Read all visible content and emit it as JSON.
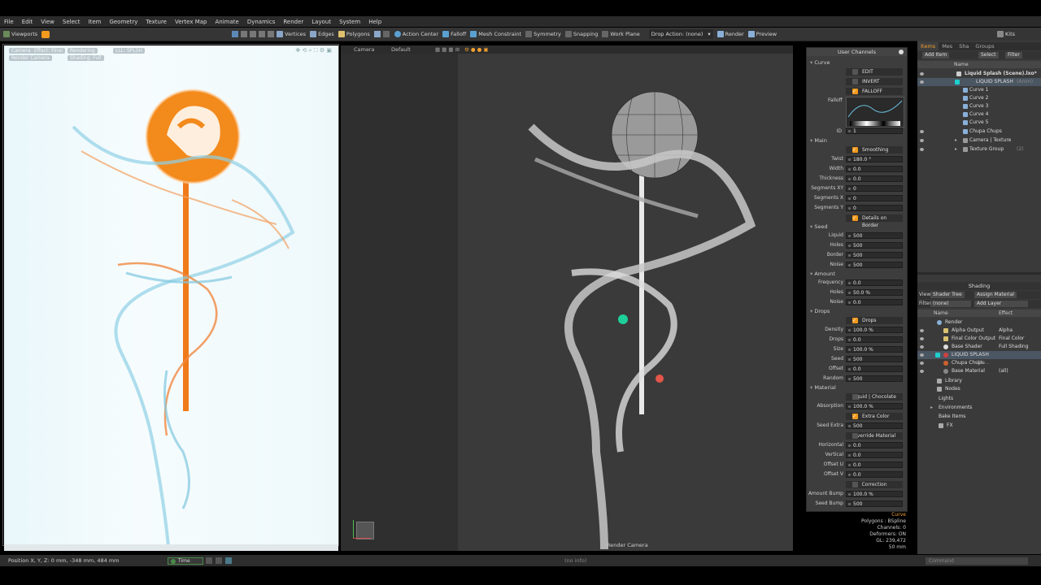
{
  "menu": [
    "File",
    "Edit",
    "View",
    "Select",
    "Item",
    "Geometry",
    "Texture",
    "Vertex Map",
    "Animate",
    "Dynamics",
    "Render",
    "Layout",
    "System",
    "Help"
  ],
  "toolbar": {
    "viewports": "Viewports",
    "vertices": "Vertices",
    "edges": "Edges",
    "polygons": "Polygons",
    "action_center": "Action Center",
    "falloff": "Falloff",
    "mesh_constraint": "Mesh Constraint",
    "symmetry": "Symmetry",
    "snapping": "Snapping",
    "work_plane": "Work Plane",
    "drop_action": "Drop Action: (none)",
    "render": "Render",
    "preview": "Preview",
    "kits": "Kits"
  },
  "viewport1": {
    "tags": [
      "Camera",
      "Effect: Final",
      "Rendering",
      "LLL: SPLSH",
      "Render Camera",
      "Shading: Full"
    ]
  },
  "viewport2": {
    "camera_tab": "Camera",
    "default_tab": "Default",
    "footer_label": "Render Camera"
  },
  "user_channels": {
    "title": "User Channels",
    "sections": {
      "curve": "Curve",
      "main": "Main",
      "seed": "Seed",
      "amount": "Amount",
      "drops": "Drops",
      "material": "Material"
    },
    "edit": "EDIT",
    "invert": "INVERT",
    "falloff_chk": "FALLOFF",
    "falloff_label": "Falloff",
    "id_label": "ID",
    "id_value": "1",
    "smoothing": "Smoothing",
    "twist_label": "Twist",
    "twist": "180.0 °",
    "width_label": "Width",
    "width": "0.0",
    "thickness_label": "Thickness",
    "thickness": "0.0",
    "segxy_label": "Segments XY",
    "segxy": "0",
    "segx_label": "Segments X",
    "segx": "0",
    "segy_label": "Segments Y",
    "segy": "0",
    "details_border": "Details on Border",
    "liquid_label": "Liquid",
    "liquid": "500",
    "holes_label": "Holes",
    "holes": "500",
    "border_label": "Border",
    "border": "500",
    "noise_label": "Noise",
    "noise": "500",
    "frequency_label": "Frequency",
    "frequency": "0.0",
    "aholes_label": "Holes",
    "aholes": "50.0 %",
    "anoise_label": "Noise",
    "anoise": "0.0",
    "drops_chk": "Drops",
    "density_label": "Density",
    "density": "100.0 %",
    "drops_label": "Drops",
    "drops": "0.0",
    "size_label": "Size",
    "size": "100.0 %",
    "dseed_label": "Seed",
    "dseed": "500",
    "offset_label": "Offset",
    "offset": "0.0",
    "random_label": "Random",
    "random": "500",
    "liquid_chocolate": "Liquid | Chocolate",
    "absorption_label": "Absorption",
    "absorption": "100.0 %",
    "extra_color": "Extra Color",
    "seed_extra_label": "Seed Extra",
    "seed_extra": "500",
    "override_material": "Override Material",
    "horizontal_label": "Horizontal",
    "horizontal": "0.0",
    "vertical_label": "Vertical",
    "vertical": "0.0",
    "offsetu_label": "Offset U",
    "offsetu": "0.0",
    "offsetv_label": "Offset V",
    "offsetv": "0.0",
    "correction": "Correction",
    "amount_bump_label": "Amount Bump",
    "amount_bump": "100.0 %",
    "seed_bump_label": "Seed Bump",
    "seed_bump": "500"
  },
  "info": {
    "l1": "Curve",
    "l2": "Polygons : BSpline",
    "l3": "Channels: 0",
    "l4": "Deformers: ON",
    "l5": "GL: 239,472",
    "l6": "50 mm"
  },
  "items_panel": {
    "tabs": [
      "Items",
      "Mes",
      "Sha",
      "Groups"
    ],
    "add_item": "Add Item",
    "select": "Select",
    "filter": "Filter",
    "name_col": "Name",
    "tree": [
      {
        "label": "Liquid Splash (Scene).lxo*",
        "bold": true
      },
      {
        "label": "LIQUID SPLASH",
        "extra": "(Anim)"
      },
      {
        "label": "Curve 1"
      },
      {
        "label": "Curve 2"
      },
      {
        "label": "Curve 3"
      },
      {
        "label": "Curve 4"
      },
      {
        "label": "Curve 5"
      },
      {
        "label": "Chupa Chups"
      },
      {
        "label": "Camera | Texture"
      },
      {
        "label": "Texture Group",
        "extra": "(2)"
      }
    ]
  },
  "shading_panel": {
    "title": "Shading",
    "view_label": "View",
    "view_value": "Shader Tree",
    "assign_material": "Assign Material",
    "filter_label": "Filter",
    "filter_value": "(none)",
    "add_layer": "Add Layer",
    "name_col": "Name",
    "effect_col": "Effect",
    "rows": [
      {
        "label": "Render",
        "effect": ""
      },
      {
        "label": "Alpha Output",
        "effect": "Alpha"
      },
      {
        "label": "Final Color Output",
        "effect": "Final Color"
      },
      {
        "label": "Base Shader",
        "effect": "Full Shading"
      },
      {
        "label": "LIQUID SPLASH",
        "effect": ""
      },
      {
        "label": "Chupa Chups",
        "effect": "(Ma..."
      },
      {
        "label": "Base Material",
        "effect": "(all)"
      },
      {
        "label": "Library",
        "effect": ""
      },
      {
        "label": "Nodes",
        "effect": ""
      },
      {
        "label": "Lights",
        "effect": ""
      },
      {
        "label": "Environments",
        "effect": ""
      },
      {
        "label": "Bake Items",
        "effect": ""
      },
      {
        "label": "FX",
        "effect": ""
      }
    ]
  },
  "status": {
    "position": "Position X, Y, Z:  0 mm, -348 mm, 484 mm",
    "time": "Time",
    "no_info": "(no info)",
    "command": "Command"
  },
  "colors": {
    "accent": "#f29a1e",
    "selection": "#4b5663",
    "splash_orange": "#f07a1a",
    "splash_blue": "#7fc7e0"
  }
}
